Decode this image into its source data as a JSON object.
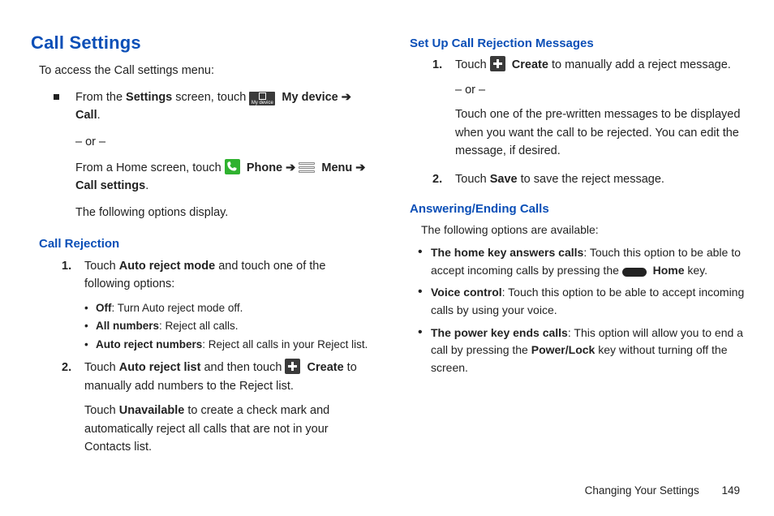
{
  "heading": "Call Settings",
  "intro": "To access the Call settings menu:",
  "access": {
    "p1a": "From the ",
    "p1b": "Settings",
    "p1c": " screen, touch ",
    "p1d": "My device",
    "p1e": "Call",
    "or": "– or –",
    "p2a": "From a Home screen, touch ",
    "p2b": "Phone",
    "p2c": "Menu",
    "p2d": "Call settings",
    "p3": "The following options display."
  },
  "callRejection": {
    "title": "Call Rejection",
    "s1a": "Touch ",
    "s1b": "Auto reject mode",
    "s1c": " and touch one of the following options:",
    "opt1b": "Off",
    "opt1t": ": Turn Auto reject mode off.",
    "opt2b": "All numbers",
    "opt2t": ": Reject all calls.",
    "opt3b": "Auto reject numbers",
    "opt3t": ": Reject all calls in your Reject list.",
    "s2a": "Touch ",
    "s2b": "Auto reject list",
    "s2c": " and then touch ",
    "s2d": "Create",
    "s2e": " to manually add numbers to the Reject list.",
    "s2f": "Touch ",
    "s2g": "Unavailable",
    "s2h": " to create a check mark and automatically reject all calls that are not in your Contacts list."
  },
  "rejectMsgs": {
    "title": "Set Up Call Rejection Messages",
    "s1a": "Touch ",
    "s1b": "Create",
    "s1c": " to manually add a reject message.",
    "or": "– or –",
    "s1d": "Touch one of the pre-written messages to be displayed when you want the call to be rejected. You can edit the message, if desired.",
    "s2a": "Touch ",
    "s2b": "Save",
    "s2c": " to save the reject message."
  },
  "answering": {
    "title": "Answering/Ending Calls",
    "intro": "The following options are available:",
    "b1a": "The home key answers calls",
    "b1b": ": Touch this option to be able to accept incoming calls by pressing the ",
    "b1c": "Home",
    "b1d": " key.",
    "b2a": "Voice control",
    "b2b": ": Touch this option to be able to accept incoming calls by using your voice.",
    "b3a": "The power key ends calls",
    "b3b": ": This option will allow you to end a call by pressing the ",
    "b3c": "Power/Lock",
    "b3d": " key without turning off the screen."
  },
  "footer": {
    "chapter": "Changing Your Settings",
    "page": "149"
  },
  "icons": {
    "mydevice_label": "My device"
  },
  "num": {
    "n1": "1.",
    "n2": "2."
  },
  "glyph": {
    "arrow": "➔",
    "bullet": "•"
  }
}
